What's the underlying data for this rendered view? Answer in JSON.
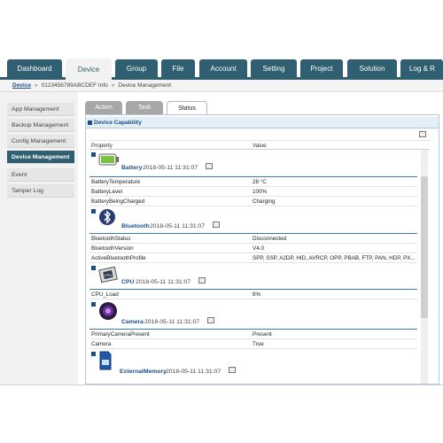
{
  "nav": {
    "tabs": [
      "Dashboard",
      "Device",
      "Group",
      "File",
      "Account",
      "Setting",
      "Project",
      "Solution",
      "Log & R"
    ],
    "active": "Device"
  },
  "breadcrumb": {
    "root": "Device",
    "device_id": "0123456789ABCDEF Info",
    "current": "Device Management"
  },
  "sidebar": {
    "items": [
      "App Management",
      "Backup Management",
      "Config Management",
      "Device Management",
      "Event",
      "Tamper Log"
    ],
    "active": "Device Management"
  },
  "subtabs": {
    "items": [
      "Action",
      "Task",
      "Status"
    ],
    "active": "Status"
  },
  "panel": {
    "title": "Device Capability",
    "col_property": "Property",
    "col_value": "Value"
  },
  "groups": [
    {
      "name": "Battery",
      "timestamp": "2018-05-11 11:31:07",
      "icon": "battery-icon",
      "rows": [
        {
          "property": "BatteryTemperature",
          "value": "28 °C"
        },
        {
          "property": "BatteryLevel",
          "value": "100%"
        },
        {
          "property": "BatteryBeingCharged",
          "value": "Charging"
        }
      ]
    },
    {
      "name": "Bluetooth",
      "timestamp": "2018-05-11 11:31:07",
      "icon": "bluetooth-icon",
      "rows": [
        {
          "property": "BluetoothStatus",
          "value": "Disconnected"
        },
        {
          "property": "BluetoothVersion",
          "value": "V4.0"
        },
        {
          "property": "ActiveBluetoothProfile",
          "value": "SPP, SSP, A2DP, HID, AVRCP, OPP, PBAB, FTP, PAN, HDP, PX..."
        }
      ]
    },
    {
      "name": "CPU",
      "timestamp": "2018-05-11 11:31:07",
      "icon": "cpu-icon",
      "rows": [
        {
          "property": "CPU_Load",
          "value": "8%"
        }
      ]
    },
    {
      "name": "Camera",
      "timestamp": "2018-05-11 11:31:07",
      "icon": "camera-icon",
      "rows": [
        {
          "property": "PrimaryCameraPresent",
          "value": "Present"
        },
        {
          "property": "Camera",
          "value": "True"
        }
      ]
    },
    {
      "name": "ExternalMemory",
      "timestamp": "2018-05-11 11:31:07",
      "icon": "memory-card-icon",
      "rows": []
    }
  ],
  "colors": {
    "nav": "#2f5f70",
    "active_side": "#2f5f70",
    "link": "#1a4f8a",
    "group_line": "#3a7ab0"
  }
}
